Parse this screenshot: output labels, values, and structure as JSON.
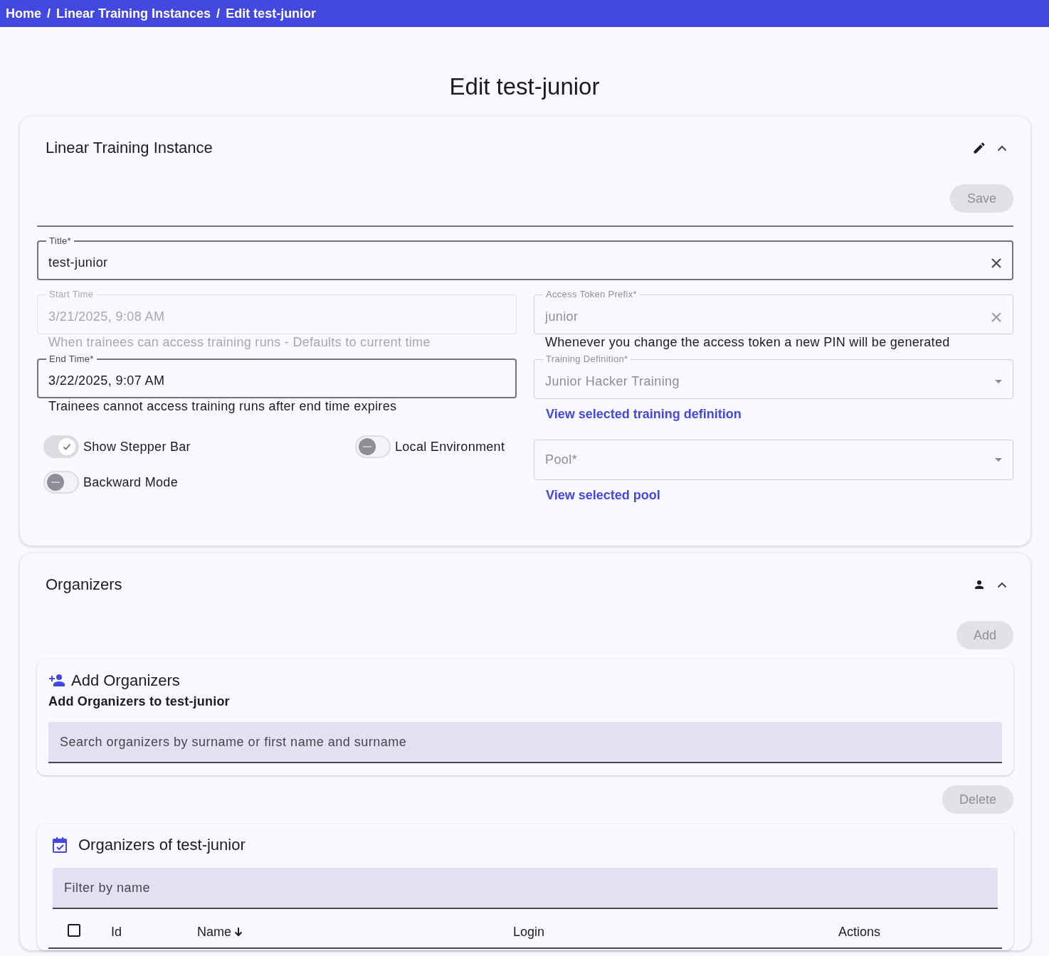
{
  "breadcrumb": [
    {
      "label": "Home"
    },
    {
      "label": "Linear Training Instances",
      "separator": "/"
    },
    {
      "label": "Edit test-junior",
      "separator": "/"
    }
  ],
  "page_title": "Edit test-junior",
  "instance_card": {
    "title": "Linear Training Instance",
    "save_button": {
      "label": "Save",
      "disabled": true
    },
    "title_field": {
      "label": "Title*",
      "value": "test-junior",
      "disabled": false,
      "readonly": false,
      "clearable": true
    },
    "start_time_field": {
      "label": "Start Time",
      "value": "3/21/2025, 9:08 AM",
      "hint": "When trainees can access training runs - Defaults to current time",
      "disabled": true
    },
    "end_time_field": {
      "label": "End Time*",
      "value": "3/22/2025, 9:07 AM",
      "hint": "Trainees cannot access training runs after end time expires",
      "disabled": false,
      "readonly": false
    },
    "toggles": [
      {
        "label": "Show Stepper Bar",
        "on": true
      },
      {
        "label": "Local Environment",
        "on": false
      },
      {
        "label": "Backward Mode",
        "on": false
      }
    ],
    "access_token_field": {
      "label": "Access Token Prefix*",
      "value": "junior",
      "hint": "Whenever you change the access token a new PIN will be generated",
      "disabled": false,
      "readonly": true,
      "clearable": true
    },
    "training_definition_field": {
      "label": "Training Definition*",
      "value": "Junior Hacker Training",
      "disabled": false,
      "readonly": true,
      "dropdown": true
    },
    "training_definition_link": "View selected training definition",
    "pool_field": {
      "placeholder": "Pool*",
      "disabled": false,
      "readonly": true,
      "dropdown": true
    },
    "pool_link": "View selected pool"
  },
  "organizers_card": {
    "title": "Organizers",
    "add_button": {
      "label": "Add",
      "disabled": true
    },
    "add_panel": {
      "title": "Add Organizers",
      "subtitle": "Add Organizers to test-junior",
      "search_placeholder": "Search organizers by surname or first name and surname"
    },
    "delete_button": {
      "label": "Delete",
      "disabled": true
    },
    "list_panel": {
      "title": "Organizers of test-junior",
      "filter_placeholder": "Filter by name",
      "select_all_checked": false,
      "columns": [
        {
          "label": "Id",
          "sorted": false
        },
        {
          "label": "Name",
          "sorted": true
        },
        {
          "label": "Login",
          "sorted": false
        },
        {
          "label": "Actions",
          "sorted": false
        }
      ]
    }
  }
}
